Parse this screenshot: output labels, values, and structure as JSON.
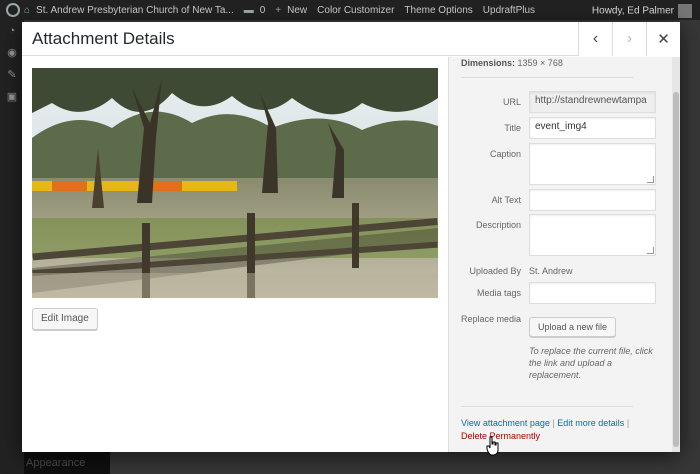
{
  "adminbar": {
    "site_name": "St. Andrew Presbyterian Church of New Ta...",
    "comments_count": "0",
    "new_label": "New",
    "items": [
      "Color Customizer",
      "Theme Options",
      "UpdraftPlus"
    ],
    "howdy": "Howdy, Ed Palmer"
  },
  "sidebar": {
    "appearance_label": "Appearance"
  },
  "modal": {
    "title": "Attachment Details",
    "prev_glyph": "‹",
    "next_glyph": "›",
    "close_glyph": "✕"
  },
  "left": {
    "edit_image_label": "Edit Image"
  },
  "details": {
    "dimensions_label": "Dimensions:",
    "dimensions_value": "1359 × 768",
    "url_label": "URL",
    "url_value": "http://standrewnewtampa",
    "title_label": "Title",
    "title_value": "event_img4",
    "caption_label": "Caption",
    "caption_value": "",
    "alt_label": "Alt Text",
    "alt_value": "",
    "description_label": "Description",
    "description_value": "",
    "uploaded_by_label": "Uploaded By",
    "uploaded_by_value": "St. Andrew",
    "media_tags_label": "Media tags",
    "media_tags_value": "",
    "replace_media_label": "Replace media",
    "upload_button_label": "Upload a new file",
    "replace_help": "To replace the current file, click the link and upload a replacement.",
    "view_attachment_link": "View attachment page",
    "edit_more_link": "Edit more details",
    "separator": "|",
    "delete_link": "Delete Permanently"
  },
  "colors": {
    "delete_red": "#aa0000",
    "link_blue": "#0073aa",
    "sidebar_bg": "#f3f3f3"
  }
}
